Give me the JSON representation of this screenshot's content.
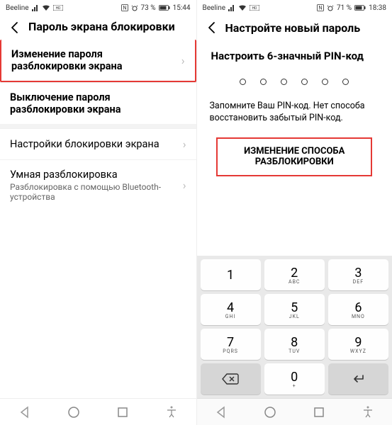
{
  "left": {
    "status": {
      "carrier": "Beeline",
      "nfc": "ℕ",
      "battery": "73 %",
      "time": "15:44"
    },
    "title": "Пароль экрана блокировки",
    "items": [
      {
        "primary": "Изменение пароля разблокировки экрана",
        "chevron": "›"
      },
      {
        "primary": "Выключение пароля разблокировки экрана"
      },
      {
        "primary": "Настройки блокировки экрана",
        "chevron": "›"
      },
      {
        "primary": "Умная разблокировка",
        "secondary": "Разблокировка с помощью Bluetooth-устройства",
        "chevron": "›"
      }
    ]
  },
  "right": {
    "status": {
      "carrier": "Beeline",
      "nfc": "ℕ",
      "battery": "71 %",
      "time": "18:38"
    },
    "title": "Настройте новый пароль",
    "setup_title": "Настроить 6-значный PIN-код",
    "note": "Запомните Ваш PIN-код. Нет способа восстановить забытый PIN-код.",
    "change_method": "ИЗМЕНЕНИЕ СПОСОБА РАЗБЛОКИРОВКИ",
    "keypad": {
      "k1": "1",
      "k2": "2",
      "k3": "3",
      "k4": "4",
      "k5": "5",
      "k6": "6",
      "k7": "7",
      "k8": "8",
      "k9": "9",
      "k0": "0",
      "s2": "ABC",
      "s3": "DEF",
      "s4": "GHI",
      "s5": "JKL",
      "s6": "MNO",
      "s7": "PQRS",
      "s8": "TUV",
      "s9": "WXYZ",
      "s0": "+"
    }
  }
}
